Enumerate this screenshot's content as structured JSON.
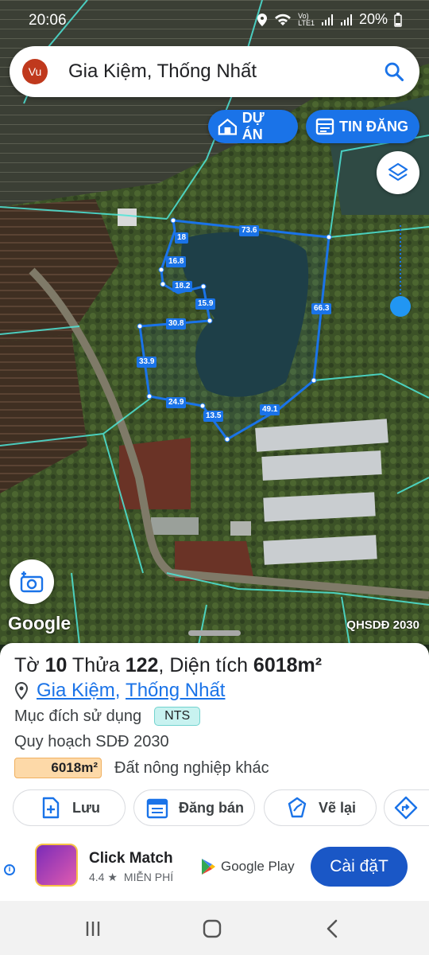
{
  "status_bar": {
    "time": "20:06",
    "battery": "20%"
  },
  "search": {
    "avatar": "Vu",
    "query": "Gia Kiệm, Thống Nhất",
    "icon": "search-icon"
  },
  "chips": {
    "du_an": "DỰ ÁN",
    "tin_dang": "TIN ĐĂNG"
  },
  "map": {
    "google_label": "Google",
    "overlay_label": "QHSDĐ 2030",
    "parcel_edges": [
      "73.6",
      "18",
      "16.8",
      "18.2",
      "15.9",
      "30.8",
      "33.9",
      "24.9",
      "13.5",
      "49.1",
      "66.3"
    ],
    "colors": {
      "parcel_outline": "#1a73e8",
      "boundary_lines": "#4ee6d8"
    }
  },
  "sheet": {
    "title_prefix": "Tờ ",
    "to_number": "10",
    "thua_prefix": " Thửa ",
    "thua_number": "122",
    "area_prefix": ", Diện tích ",
    "area_value": "6018m²",
    "location_commune": "Gia Kiệm",
    "location_sep": ",",
    "location_district": "Thống Nhất",
    "purpose_label": "Mục đích sử dụng",
    "purpose_code": "NTS",
    "plan_label": "Quy hoạch SDĐ 2030",
    "plan_area": "6018m²",
    "plan_type": "Đất nông nghiệp khác",
    "actions": {
      "save": "Lưu",
      "sell": "Đăng bán",
      "redraw": "Vẽ lại"
    }
  },
  "ad": {
    "title": "Click Match",
    "rating": "4.4 ★",
    "price": "MIỄN PHÍ",
    "store": "Google Play",
    "install": "Cài đặT"
  }
}
